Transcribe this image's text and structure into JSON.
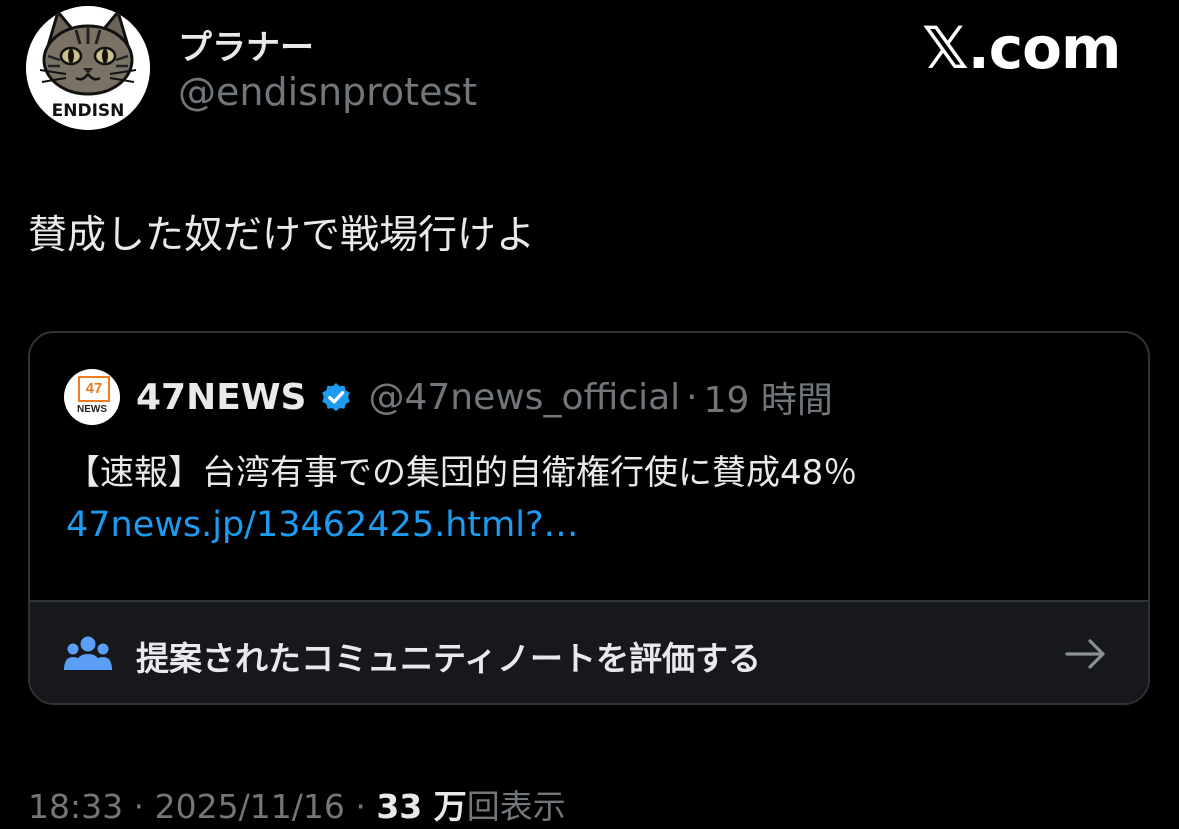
{
  "header": {
    "display_name": "プラナー",
    "handle": "@endisnprotest",
    "avatar_text": "ENDISN",
    "site_logo": "𝕏.com"
  },
  "tweet": {
    "text": "賛成した奴だけで戦場行けよ"
  },
  "quote": {
    "avatar_line1": "47",
    "avatar_line2": "NEWS",
    "name": "47NEWS",
    "verified_icon": "verified-badge-icon",
    "handle": "@47news_official",
    "separator": "·",
    "time": "19 時間",
    "text": "【速報】台湾有事での集団的自衛権行使に賛成48％",
    "link": "47news.jp/13462425.html?…"
  },
  "community_note": {
    "icon": "people-icon",
    "label": "提案されたコミュニティノートを評価する",
    "arrow_icon": "arrow-right-icon"
  },
  "meta": {
    "time": "18:33",
    "sep1": "·",
    "date": "2025/11/16",
    "sep2": "·",
    "views_count": "33 万",
    "views_label": "回表示"
  },
  "colors": {
    "background": "#000000",
    "text": "#e7e9ea",
    "secondary": "#71767b",
    "link": "#1d9bf0",
    "border": "#2f3336",
    "verified": "#1d9bf0",
    "news_orange": "#f07a1e"
  }
}
